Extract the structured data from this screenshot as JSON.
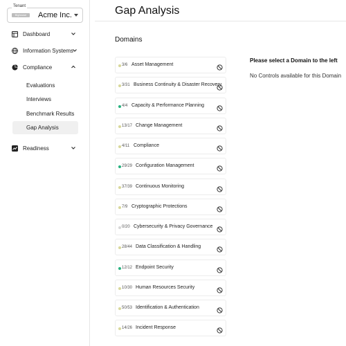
{
  "tenant": {
    "legend": "Tenant",
    "tag": "Bighouse",
    "name": "Acme Inc."
  },
  "sidebar": {
    "items": [
      {
        "label": "Dashboard",
        "icon": "dashboard-icon",
        "expanded": false
      },
      {
        "label": "Information Systems",
        "icon": "globe-icon",
        "expanded": false
      },
      {
        "label": "Compliance",
        "icon": "pie-chart-icon",
        "expanded": true
      },
      {
        "label": "Readiness",
        "icon": "readiness-icon",
        "expanded": false
      }
    ],
    "compliance_sub": [
      {
        "label": "Evaluations"
      },
      {
        "label": "Interviews"
      },
      {
        "label": "Benchmark Results"
      },
      {
        "label": "Gap Analysis",
        "active": true
      }
    ]
  },
  "page": {
    "title": "Gap Analysis",
    "domains_title": "Domains",
    "select_message": "Please select a Domain to the left",
    "no_controls": "No Controls available for this Domain"
  },
  "colors": {
    "complete": "#27b27f",
    "partial": "#d8d89a",
    "none": "#d6d6d6"
  },
  "domains": [
    {
      "count": "3/6",
      "name": "Asset Management",
      "status": "partial"
    },
    {
      "count": "3/31",
      "name": "Business Continuity & Disaster Recovery",
      "status": "partial"
    },
    {
      "count": "4/4",
      "name": "Capacity & Performance Planning",
      "status": "done"
    },
    {
      "count": "13/17",
      "name": "Change Management",
      "status": "partial"
    },
    {
      "count": "4/11",
      "name": "Compliance",
      "status": "partial"
    },
    {
      "count": "29/29",
      "name": "Configuration Management",
      "status": "done"
    },
    {
      "count": "37/39",
      "name": "Continuous Monitoring",
      "status": "partial"
    },
    {
      "count": "7/9",
      "name": "Cryptographic Protections",
      "status": "partial"
    },
    {
      "count": "0/20",
      "name": "Cybersecurity & Privacy Governance",
      "status": "none"
    },
    {
      "count": "28/44",
      "name": "Data Classification & Handling",
      "status": "partial"
    },
    {
      "count": "12/12",
      "name": "Endpoint Security",
      "status": "done"
    },
    {
      "count": "10/30",
      "name": "Human Resources Security",
      "status": "partial"
    },
    {
      "count": "50/53",
      "name": "Identification & Authentication",
      "status": "partial"
    },
    {
      "count": "14/26",
      "name": "Incident Response",
      "status": "partial"
    }
  ]
}
